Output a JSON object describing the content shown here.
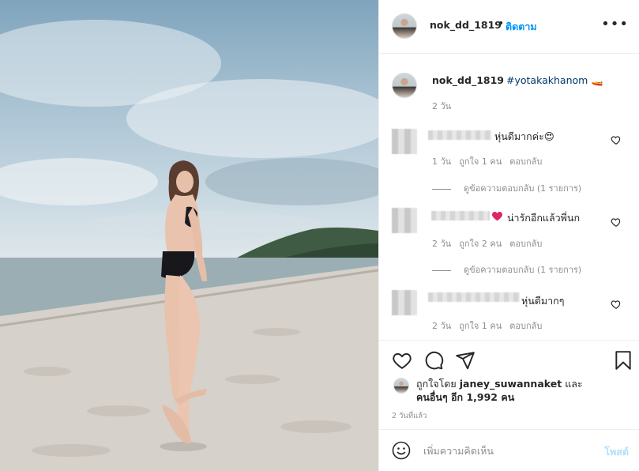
{
  "post": {
    "username": "nok_dd_1819",
    "follow_label": "ติดตาม",
    "dot": "•",
    "more": "•••",
    "caption": {
      "username": "nok_dd_1819",
      "hashtag": "#yotakakhanom",
      "emoji": "🚤",
      "time": "2 วัน"
    }
  },
  "comments": [
    {
      "text": "หุ่นดีมากค่ะ😍",
      "time": "1 วัน",
      "likes": "ถูกใจ 1 คน",
      "reply": "ตอบกลับ",
      "view_replies": "ดูข้อความตอบกลับ (1 รายการ)"
    },
    {
      "text": "น่ารักอีกแล้วพี่นก",
      "emoji": "❤️",
      "time": "2 วัน",
      "likes": "ถูกใจ 2 คน",
      "reply": "ตอบกลับ",
      "view_replies": "ดูข้อความตอบกลับ (1 รายการ)"
    },
    {
      "text": "หุ่นดีมากๆ",
      "time": "2 วัน",
      "likes": "ถูกใจ 1 คน",
      "reply": "ตอบกลับ"
    }
  ],
  "actions": {
    "liked_by_prefix": "ถูกใจโดย",
    "liked_by_user": "janey_suwannaket",
    "liked_by_and": "และ",
    "liked_by_others": "คนอื่นๆ อีก 1,992 คน",
    "timestamp": "2 วันที่แล้ว"
  },
  "add_comment": {
    "placeholder": "เพิ่มความคิดเห็น",
    "post_label": "โพสต์"
  },
  "colors": {
    "accent": "#0095f6",
    "hashtag": "#00376b",
    "muted": "#8e8e8e",
    "post_disabled": "#b2dffc",
    "heart_red": "#ed4956"
  },
  "icons": [
    "heart-icon",
    "comment-icon",
    "share-icon",
    "bookmark-icon",
    "smile-icon",
    "more-icon"
  ]
}
